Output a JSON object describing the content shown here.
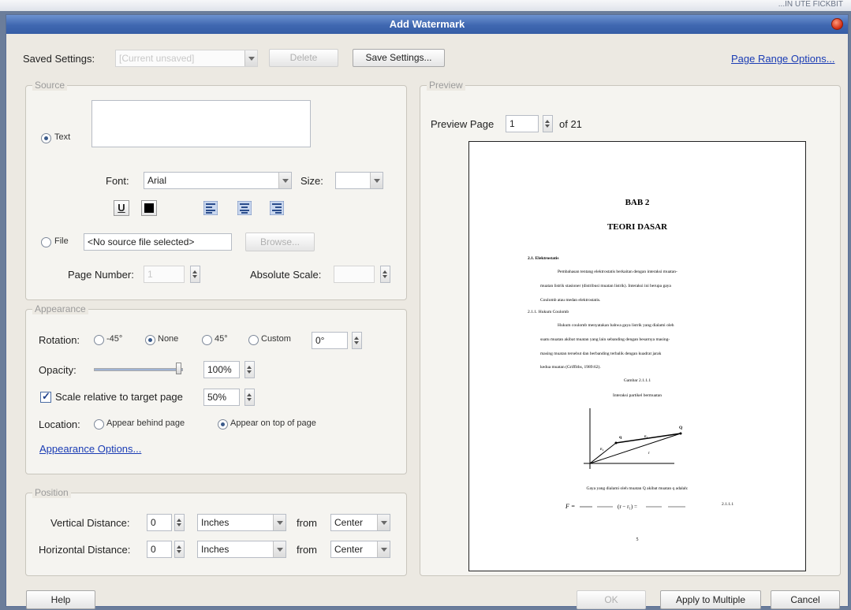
{
  "desktop": {
    "corner_text": "...IN UTE FICKBIT"
  },
  "window": {
    "title": "Add Watermark"
  },
  "top": {
    "saved_settings_label": "Saved Settings:",
    "saved_settings_value": "[Current unsaved]",
    "delete_label": "Delete",
    "save_settings_label": "Save Settings...",
    "page_range_link": "Page Range Options..."
  },
  "source": {
    "title": "Source",
    "text_option": "Text",
    "text_value": "",
    "font_label": "Font:",
    "font_value": "Arial",
    "size_label": "Size:",
    "size_value": "",
    "underline_label": "U",
    "file_option": "File",
    "file_value": "<No source file selected>",
    "browse_label": "Browse...",
    "page_number_label": "Page Number:",
    "page_number_value": "1",
    "absolute_scale_label": "Absolute Scale:",
    "absolute_scale_value": ""
  },
  "appearance": {
    "title": "Appearance",
    "rotation_label": "Rotation:",
    "rot_neg45": "-45°",
    "rot_none": "None",
    "rot_45": "45°",
    "rot_custom": "Custom",
    "rot_custom_value": "0°",
    "opacity_label": "Opacity:",
    "opacity_value": "100%",
    "opacity_level": 1.0,
    "scale_label": "Scale relative to target page",
    "scale_value": "50%",
    "location_label": "Location:",
    "behind_label": "Appear behind page",
    "ontop_label": "Appear on top of page",
    "options_link": "Appearance Options..."
  },
  "position": {
    "title": "Position",
    "vertical_label": "Vertical Distance:",
    "vertical_value": "0",
    "vertical_unit": "Inches",
    "from_label": "from",
    "vertical_from": "Center",
    "horizontal_label": "Horizontal Distance:",
    "horizontal_value": "0",
    "horizontal_unit": "Inches",
    "horizontal_from": "Center"
  },
  "preview": {
    "title": "Preview",
    "page_label": "Preview Page",
    "page_value": "1",
    "of_label": "of 21",
    "doc": {
      "heading1": "BAB 2",
      "heading2": "TEORI DASAR",
      "section": "2.1. Elektrostatis",
      "para1_l1": "Pembahasan tentang elektrostatis berkaitan dengan interaksi muatan-",
      "para1_l2": "muatan listrik stasioner (distribusi muatan listrik). Interaksi ini berupa gaya",
      "para1_l3": "Coulomb atau medan elektrostatis.",
      "subsection": "2.1.1.  Hukum Coulomb",
      "para2_l1": "Hukum coulomb menyatakan bahwa gaya listrik yang dialami oleh",
      "para2_l2": "suatu muatan akibat muatan yang lain sebanding dengan besarnya masing-",
      "para2_l3": "masing muatan tersebut dan berbanding terbalik dengan kuadrat jarak",
      "para2_l4": "kedua muatan (Griffiths, 1989:62).",
      "fig_num": "Gambar 2.1.1.1",
      "fig_caption": "Interaksi partikel bermuatan",
      "fig_q": "q",
      "fig_Q": "Q",
      "fig_r1": "r₁",
      "fig_r2": "r₂",
      "fig_r": "r",
      "force_text": "Gaya yang dialami oleh muatan Q akibat muatan q adalah:",
      "equation_no": "2.1.1.1",
      "page_no": "5"
    }
  },
  "bottom": {
    "help_label": "Help",
    "ok_label": "OK",
    "apply_multiple_label": "Apply to Multiple",
    "cancel_label": "Cancel"
  }
}
